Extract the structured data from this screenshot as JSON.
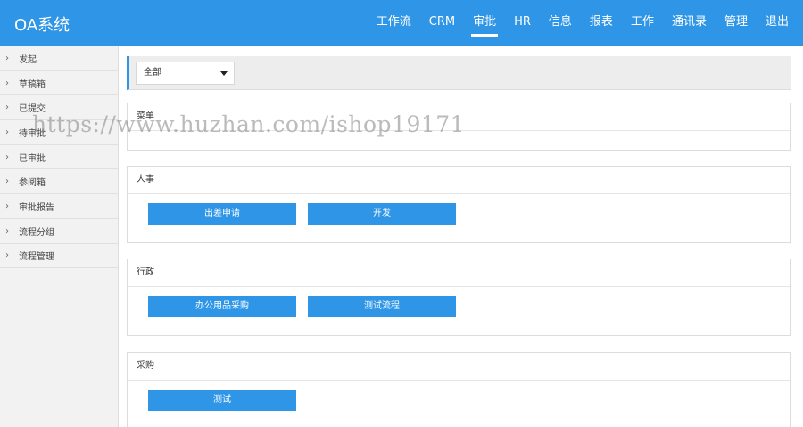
{
  "header": {
    "brand": "OA系统",
    "nav": [
      {
        "label": "工作流"
      },
      {
        "label": "CRM"
      },
      {
        "label": "审批",
        "active": true
      },
      {
        "label": "HR"
      },
      {
        "label": "信息"
      },
      {
        "label": "报表"
      },
      {
        "label": "工作"
      },
      {
        "label": "通讯录"
      },
      {
        "label": "管理"
      },
      {
        "label": "退出"
      }
    ]
  },
  "sidebar": {
    "items": [
      {
        "label": "发起"
      },
      {
        "label": "草稿箱"
      },
      {
        "label": "已提交"
      },
      {
        "label": "待审批"
      },
      {
        "label": "已审批"
      },
      {
        "label": "参阅箱"
      },
      {
        "label": "审批报告"
      },
      {
        "label": "流程分组"
      },
      {
        "label": "流程管理"
      }
    ]
  },
  "filter": {
    "selected": "全部"
  },
  "groups": [
    {
      "title": "菜单",
      "buttons": []
    },
    {
      "title": "人事",
      "buttons": [
        "出差申请",
        "开发"
      ]
    },
    {
      "title": "行政",
      "buttons": [
        "办公用品采购",
        "测试流程"
      ]
    },
    {
      "title": "采购",
      "buttons": [
        "测试"
      ]
    }
  ],
  "watermark": "https://www.huzhan.com/ishop19171",
  "colors": {
    "primary": "#2f95e6",
    "sidebar_bg": "#f2f2f2",
    "filter_bg": "#ededed"
  },
  "icons": {
    "sidebar_item": "chevron-right-icon",
    "select": "caret-down-icon"
  }
}
